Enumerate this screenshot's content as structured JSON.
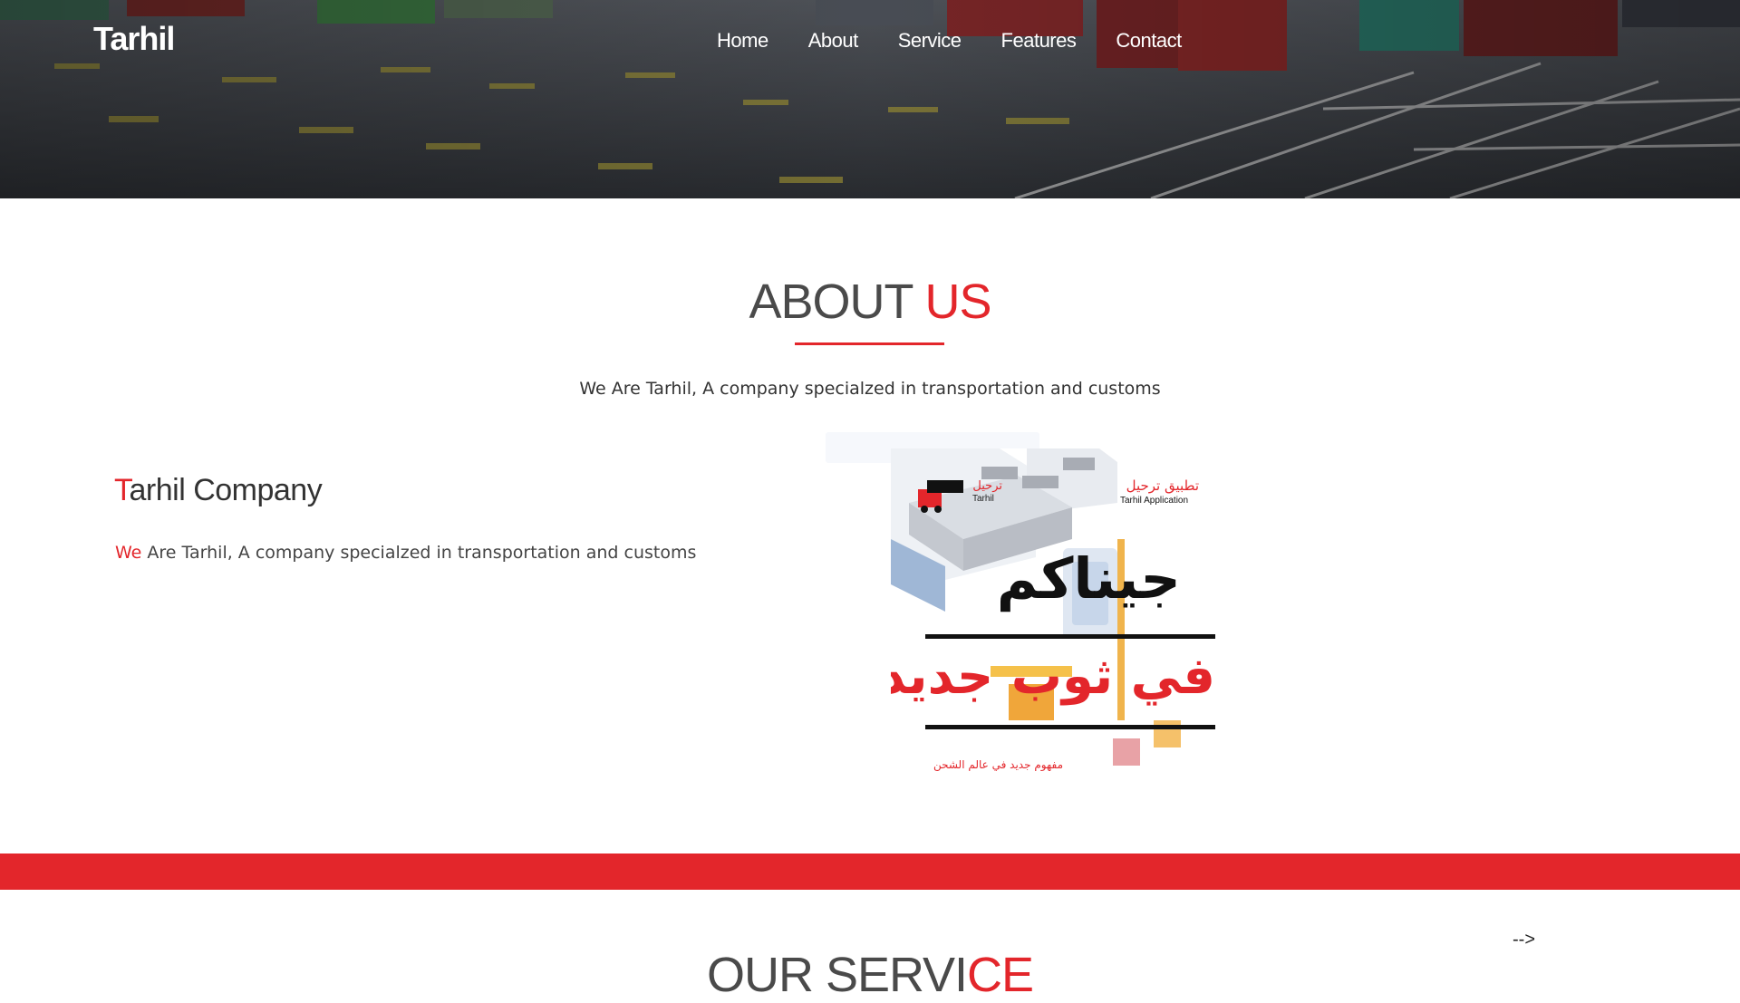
{
  "brand": "Tarhil",
  "nav": {
    "items": [
      {
        "label": "Home"
      },
      {
        "label": "About"
      },
      {
        "label": "Service"
      },
      {
        "label": "Features"
      },
      {
        "label": "Contact"
      }
    ]
  },
  "about": {
    "title_main": "ABOUT",
    "title_accent": "US",
    "subtitle": "We Are Tarhil, A company specialzed in transportation and customs",
    "company_title_first": "T",
    "company_title_rest": "arhil Company",
    "company_text_first": "We",
    "company_text_rest": " Are Tarhil, A company specialzed in transportation and customs"
  },
  "promo": {
    "logo_ar": "ترحيل",
    "logo_en": "Tarhil",
    "app_ar": "تطبيق ترحيل",
    "app_en": "Tarhil Application",
    "headline_ar": "جيناكم",
    "headline2_ar": "في ثوب جديد",
    "tagline_ar": "مفهوم جديد في عالم الشحن"
  },
  "stray_text": "-->",
  "service": {
    "title_main": "OUR SERVI",
    "title_accent": "CE"
  },
  "colors": {
    "accent": "#e3262b",
    "text": "#4a4a4a"
  }
}
